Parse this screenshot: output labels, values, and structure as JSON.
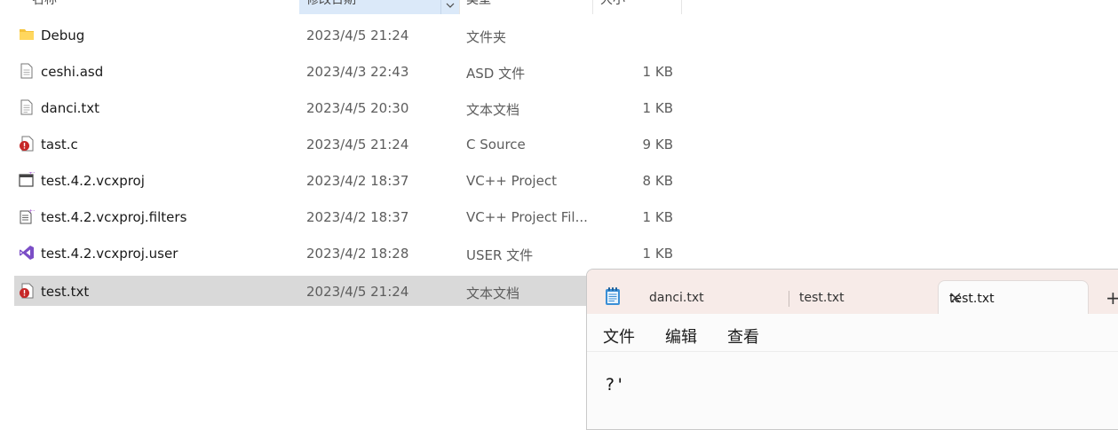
{
  "columns": {
    "name": "名称",
    "date": "修改日期",
    "type": "类型",
    "size": "大小"
  },
  "files": [
    {
      "name": "Debug",
      "date": "2023/4/5 21:24",
      "type": "文件夹",
      "size": "",
      "icon": "folder-icon"
    },
    {
      "name": "ceshi.asd",
      "date": "2023/4/3 22:43",
      "type": "ASD 文件",
      "size": "1 KB",
      "icon": "file-generic-icon"
    },
    {
      "name": "danci.txt",
      "date": "2023/4/5 20:30",
      "type": "文本文档",
      "size": "1 KB",
      "icon": "text-file-icon"
    },
    {
      "name": "tast.c",
      "date": "2023/4/5 21:24",
      "type": "C Source",
      "size": "9 KB",
      "icon": "c-source-icon"
    },
    {
      "name": "test.4.2.vcxproj",
      "date": "2023/4/2 18:37",
      "type": "VC++ Project",
      "size": "8 KB",
      "icon": "vcxproj-icon"
    },
    {
      "name": "test.4.2.vcxproj.filters",
      "date": "2023/4/2 18:37",
      "type": "VC++ Project Fil...",
      "size": "1 KB",
      "icon": "vcxproj-filters-icon"
    },
    {
      "name": "test.4.2.vcxproj.user",
      "date": "2023/4/2 18:28",
      "type": "USER 文件",
      "size": "1 KB",
      "icon": "visual-studio-icon"
    },
    {
      "name": "test.txt",
      "date": "2023/4/5 21:24",
      "type": "文本文档",
      "size": "",
      "icon": "c-source-icon",
      "selected": true
    }
  ],
  "notepad": {
    "tabs": [
      {
        "label": "danci.txt"
      },
      {
        "label": "test.txt"
      },
      {
        "label": "test.txt",
        "active": true
      }
    ],
    "add_tab": "+",
    "menu": [
      "文件",
      "编辑",
      "查看"
    ],
    "content": "?'"
  },
  "colors": {
    "selected_row": "#d9d9d9",
    "sorted_header": "#dbe9f9",
    "tabbar_bg": "#f7ebe8",
    "folder_yellow": "#f5c33b"
  }
}
